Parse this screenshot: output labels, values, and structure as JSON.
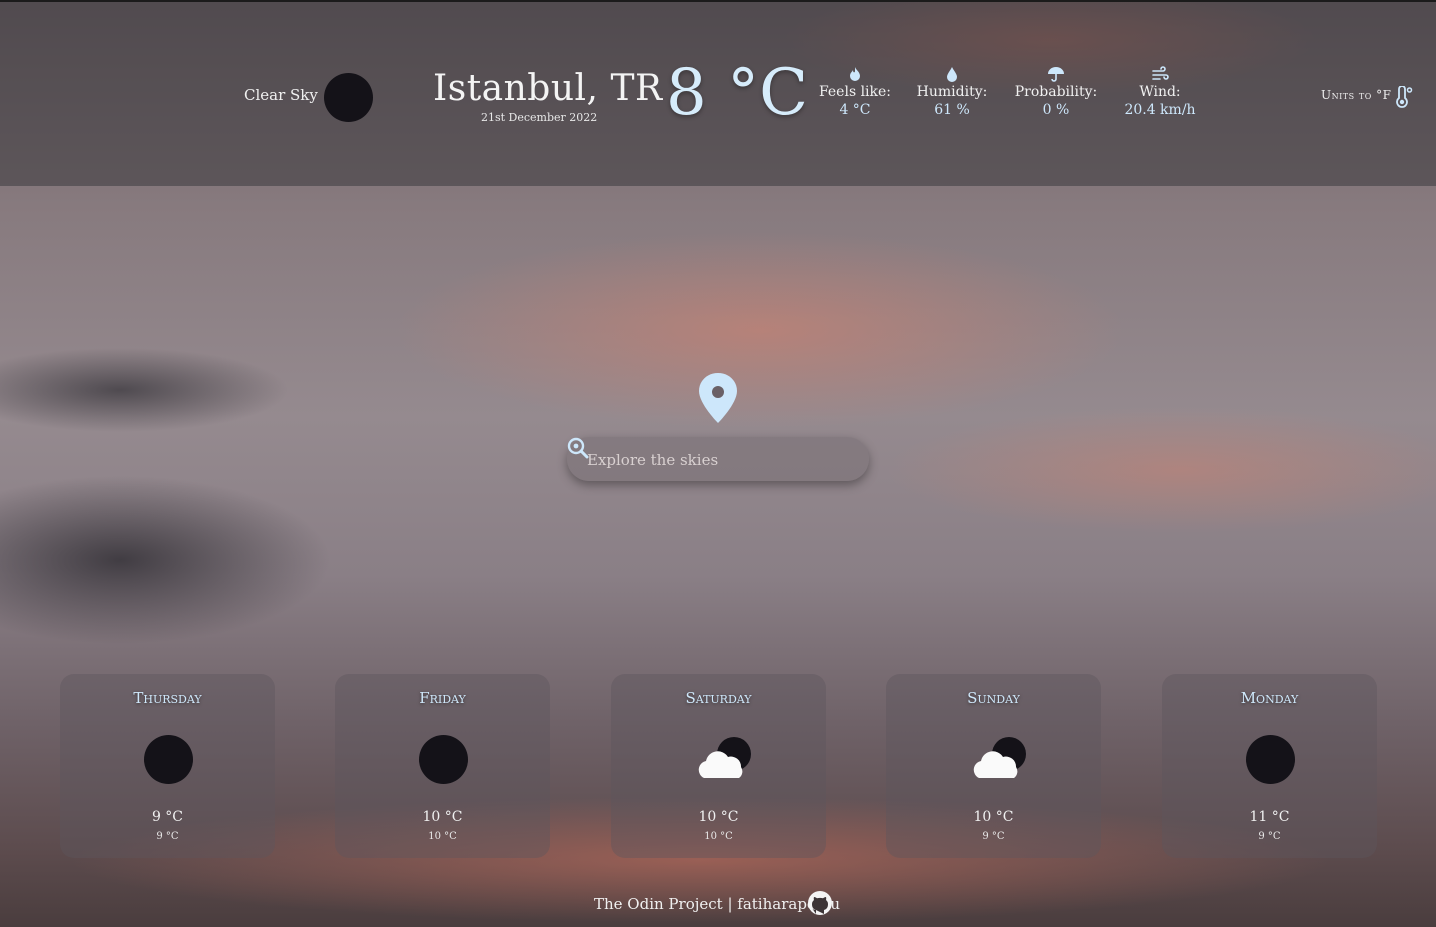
{
  "current": {
    "condition": "Clear Sky",
    "icon": "moon-dark-icon",
    "city": "Istanbul, TR",
    "date": "21st December 2022",
    "temp": "8 °C"
  },
  "stats": [
    {
      "icon": "flame-icon",
      "label": "Feels like:",
      "value": "4 °C"
    },
    {
      "icon": "droplet-icon",
      "label": "Humidity:",
      "value": "61 %"
    },
    {
      "icon": "umbrella-icon",
      "label": "Probability:",
      "value": "0 %"
    },
    {
      "icon": "wind-icon",
      "label": "Wind:",
      "value": "20.4 km/h"
    }
  ],
  "units_toggle": "Units to °F",
  "search": {
    "placeholder": "Explore the skies"
  },
  "forecast": [
    {
      "day": "Thursday",
      "icon": "moon-dark-icon",
      "hi": "9 °C",
      "lo": "9 °C"
    },
    {
      "day": "Friday",
      "icon": "moon-dark-icon",
      "hi": "10 °C",
      "lo": "10 °C"
    },
    {
      "day": "Saturday",
      "icon": "cloud-moon-icon",
      "hi": "10 °C",
      "lo": "10 °C"
    },
    {
      "day": "Sunday",
      "icon": "cloud-moon-icon",
      "hi": "10 °C",
      "lo": "9 °C"
    },
    {
      "day": "Monday",
      "icon": "moon-dark-icon",
      "hi": "11 °C",
      "lo": "9 °C"
    }
  ],
  "footer": {
    "text": "The Odin Project | fatiharapoglu"
  },
  "colors": {
    "accent": "#cde7fb",
    "orb": "#141218"
  }
}
